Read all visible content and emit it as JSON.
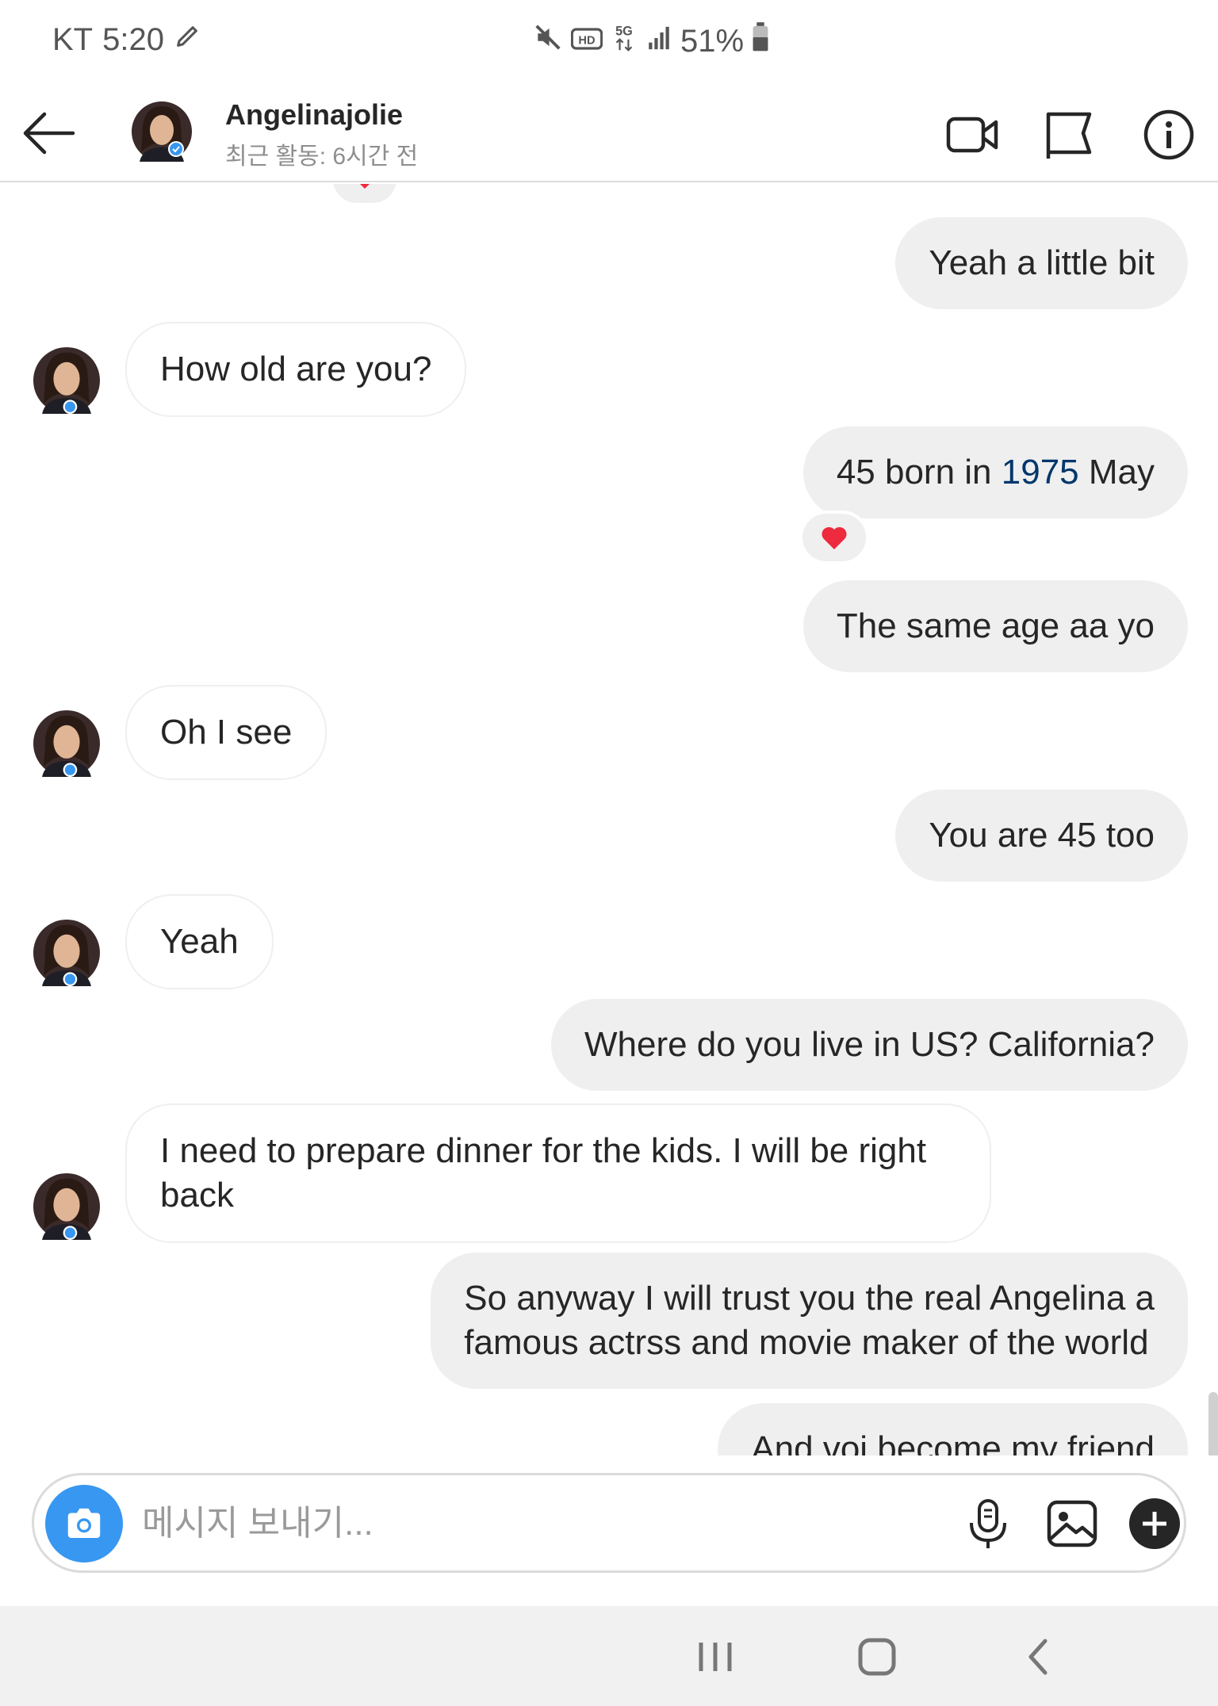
{
  "status_bar": {
    "carrier": "KT",
    "time": "5:20",
    "battery": "51%",
    "icons": [
      "edit-icon",
      "mute-icon",
      "hd-icon",
      "5g-icon",
      "signal-icon",
      "battery-icon"
    ]
  },
  "header": {
    "name": "Angelinajolie",
    "activity": "최근 활동: 6시간 전",
    "icons": [
      "back-arrow-icon",
      "video-call-icon",
      "flag-icon",
      "info-icon"
    ]
  },
  "messages": [
    {
      "sender": "me",
      "text": "Yeah a little bit"
    },
    {
      "sender": "them",
      "text": "How old are you?"
    },
    {
      "sender": "me",
      "text_before": "45 born in ",
      "link": "1975",
      "text_after": " May",
      "reaction": "❤️"
    },
    {
      "sender": "me",
      "text": "The same age aa yo"
    },
    {
      "sender": "them",
      "text": "Oh I see"
    },
    {
      "sender": "me",
      "text": "You are 45 too"
    },
    {
      "sender": "them",
      "text": "Yeah"
    },
    {
      "sender": "me",
      "text": "Where do you live in US? California?"
    },
    {
      "sender": "them",
      "line1": "I need to prepare dinner for the kids. I will be right",
      "line2": "back"
    },
    {
      "sender": "me",
      "line1": "So anyway I will trust you the real Angelina a",
      "line2": "famous actrss and movie maker of the world"
    },
    {
      "sender": "me",
      "text": "And voi become my friend"
    }
  ],
  "composer": {
    "placeholder": "메시지 보내기..."
  },
  "colors": {
    "accent": "#3897f0",
    "bubble_me": "#efefef",
    "link": "#00376b",
    "reaction_heart": "#ed2a3e"
  }
}
